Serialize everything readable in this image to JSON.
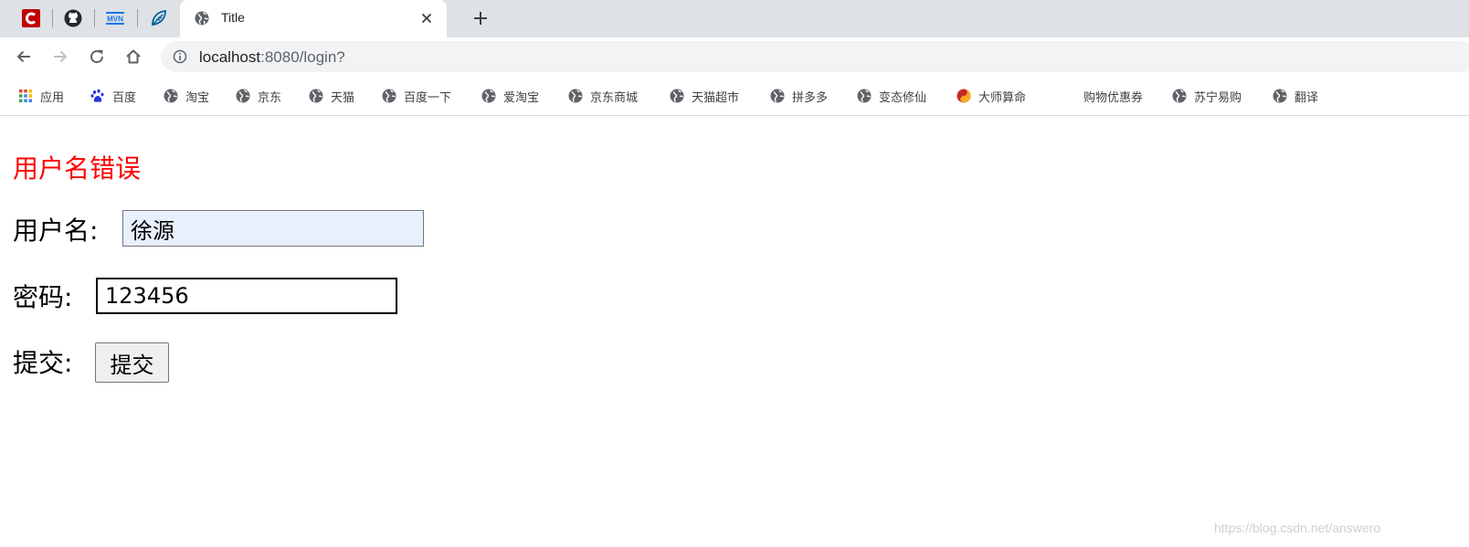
{
  "browser": {
    "active_tab": {
      "title": "Title"
    },
    "pinned_tabs": [
      {
        "icon": "csdn-icon",
        "color": "#c00000"
      },
      {
        "icon": "github-icon",
        "color": "#24292e"
      },
      {
        "icon": "mvn-icon",
        "label": "MVN",
        "color": "#1a73e8"
      },
      {
        "icon": "thymeleaf-icon",
        "color": "#005f9e"
      }
    ],
    "address_bar": {
      "host": "localhost",
      "rest": ":8080/login?"
    }
  },
  "bookmarks": [
    {
      "label": "应用",
      "icon": "apps-grid-icon"
    },
    {
      "label": "百度",
      "icon": "baidu-paw-icon"
    },
    {
      "label": "淘宝",
      "icon": "globe-icon"
    },
    {
      "label": "京东",
      "icon": "globe-icon"
    },
    {
      "label": "天猫",
      "icon": "globe-icon"
    },
    {
      "label": "百度一下",
      "icon": "globe-icon"
    },
    {
      "label": "爱淘宝",
      "icon": "globe-icon"
    },
    {
      "label": "京东商城",
      "icon": "globe-icon"
    },
    {
      "label": "天猫超市",
      "icon": "globe-icon"
    },
    {
      "label": "拼多多",
      "icon": "globe-icon"
    },
    {
      "label": "变态修仙",
      "icon": "globe-icon"
    },
    {
      "label": "大师算命",
      "icon": "yin-yang-icon"
    },
    {
      "label": "购物优惠券",
      "icon": "none"
    },
    {
      "label": "苏宁易购",
      "icon": "globe-icon"
    },
    {
      "label": "翻译",
      "icon": "globe-icon"
    }
  ],
  "page": {
    "error_message": "用户名错误",
    "error_color": "#ff0000",
    "username_label": "用户名:",
    "username_value": "徐源",
    "password_label": "密码:",
    "password_value": "123456",
    "submit_label": "提交:",
    "submit_button": "提交"
  },
  "watermark": "https://blog.csdn.net/answero"
}
